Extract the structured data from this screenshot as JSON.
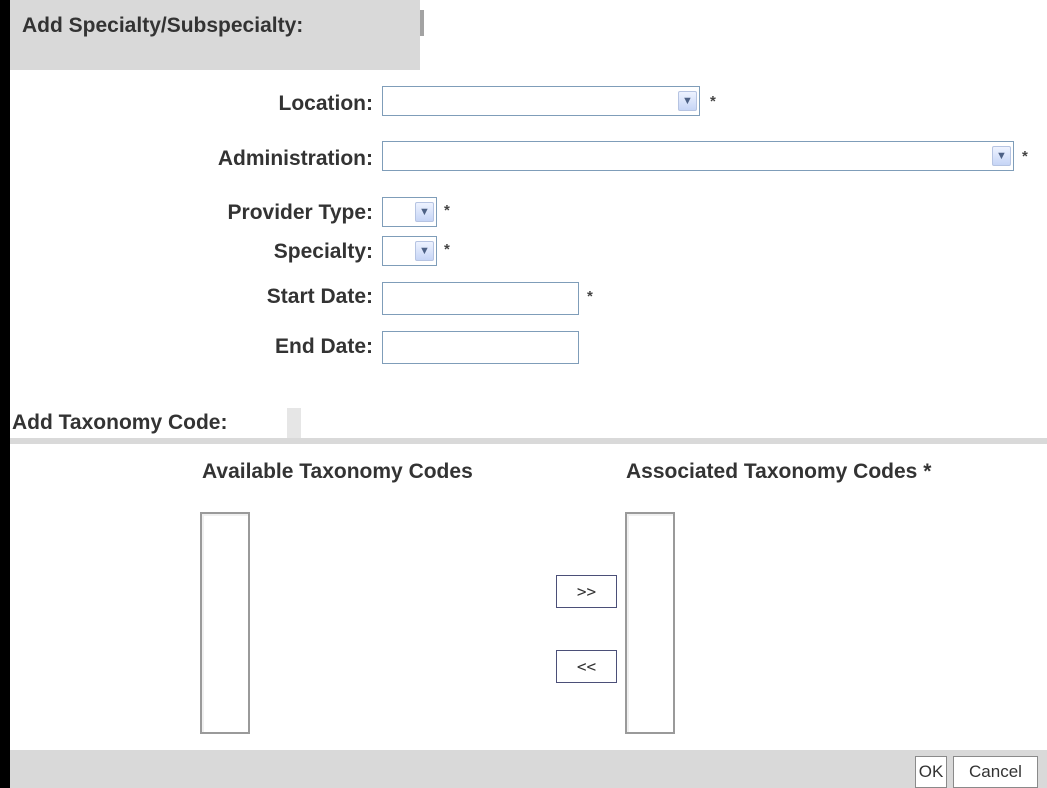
{
  "header": {
    "title": "Add Specialty/Subspecialty:"
  },
  "form": {
    "location": {
      "label": "Location:",
      "value": "",
      "required": "*"
    },
    "administration": {
      "label": "Administration:",
      "value": "",
      "required": "*"
    },
    "provider_type": {
      "label": "Provider Type:",
      "value": "",
      "required": "*"
    },
    "specialty": {
      "label": "Specialty:",
      "value": "",
      "required": "*"
    },
    "start_date": {
      "label": "Start Date:",
      "value": "",
      "required": "*"
    },
    "end_date": {
      "label": "End Date:",
      "value": ""
    }
  },
  "taxonomy": {
    "title": "Add Taxonomy Code:",
    "available_label": "Available Taxonomy Codes",
    "associated_label": "Associated Taxonomy Codes *",
    "add_label": ">>",
    "remove_label": "<<"
  },
  "footer": {
    "ok_label": "OK",
    "cancel_label": "Cancel"
  },
  "icons": {
    "dropdown_arrow": "chevron-down-icon"
  },
  "colors": {
    "panel_gray": "#d9d9d9",
    "input_border": "#7f9db9",
    "dropdown_button": "#c6d5f6"
  }
}
